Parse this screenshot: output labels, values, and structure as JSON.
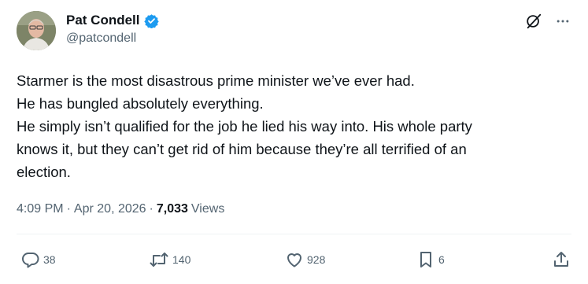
{
  "author": {
    "display_name": "Pat Condell",
    "handle": "@patcondell",
    "verified": true
  },
  "icons": {
    "verified": "verified-badge-icon",
    "grok": "grok-icon",
    "more": "more-icon",
    "reply": "reply-icon",
    "retweet": "retweet-icon",
    "like": "like-icon",
    "bookmark": "bookmark-icon",
    "share": "share-icon"
  },
  "colors": {
    "accent": "#1d9bf0",
    "text": "#0f1419",
    "muted": "#536471"
  },
  "tweet": {
    "lines": [
      "Starmer is the most disastrous prime minister we’ve ever had.",
      "He has bungled absolutely everything.",
      "He simply isn’t qualified for the job he lied his way into. His whole party",
      "knows it, but they can’t get rid of him because they’re all terrified of an",
      "election."
    ]
  },
  "meta": {
    "time": "4:09 PM",
    "dot1": "·",
    "date": "Apr 20, 2026",
    "dot2": "·",
    "views_count": "7,033",
    "views_label": "Views"
  },
  "actions": {
    "replies": "38",
    "retweets": "140",
    "likes": "928",
    "bookmarks": "6"
  }
}
